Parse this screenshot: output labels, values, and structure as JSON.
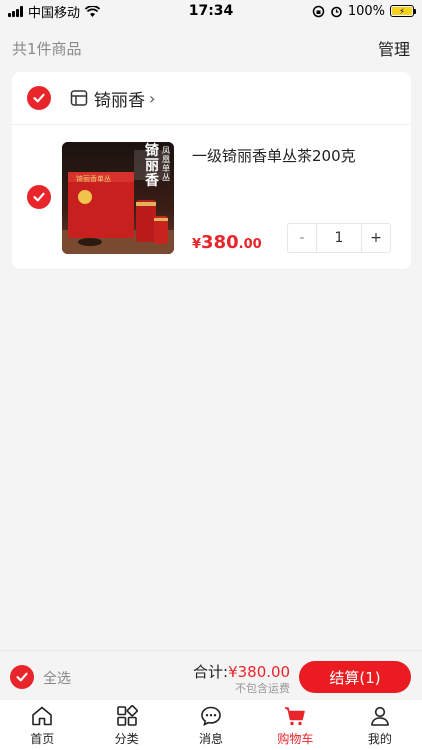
{
  "status_bar": {
    "carrier": "中国移动",
    "time": "17:34",
    "battery": "100%"
  },
  "header": {
    "item_count": "共1件商品",
    "manage_label": "管理"
  },
  "shop": {
    "name": "锜丽香",
    "arrow": "›"
  },
  "item": {
    "title": "一级锜丽香单丛茶200克",
    "price_symbol": "¥",
    "price_int": "380",
    "price_dec": ".00",
    "quantity": "1",
    "minus_label": "-",
    "plus_label": "+",
    "image_text_main": "锜丽香",
    "image_text_sub": "凤凰单丛",
    "image_box_text": "锜丽香单丛"
  },
  "checkout": {
    "select_all_label": "全选",
    "total_label": "合计:",
    "total_value": "¥380.00",
    "shipping_note": "不包含运费",
    "pay_label": "结算(1)"
  },
  "tabs": [
    {
      "label": "首页",
      "icon": "home-icon"
    },
    {
      "label": "分类",
      "icon": "category-icon"
    },
    {
      "label": "消息",
      "icon": "message-icon"
    },
    {
      "label": "购物车",
      "icon": "cart-icon"
    },
    {
      "label": "我的",
      "icon": "profile-icon"
    }
  ],
  "colors": {
    "accent": "#e8252b",
    "background": "#f4f4f4"
  }
}
